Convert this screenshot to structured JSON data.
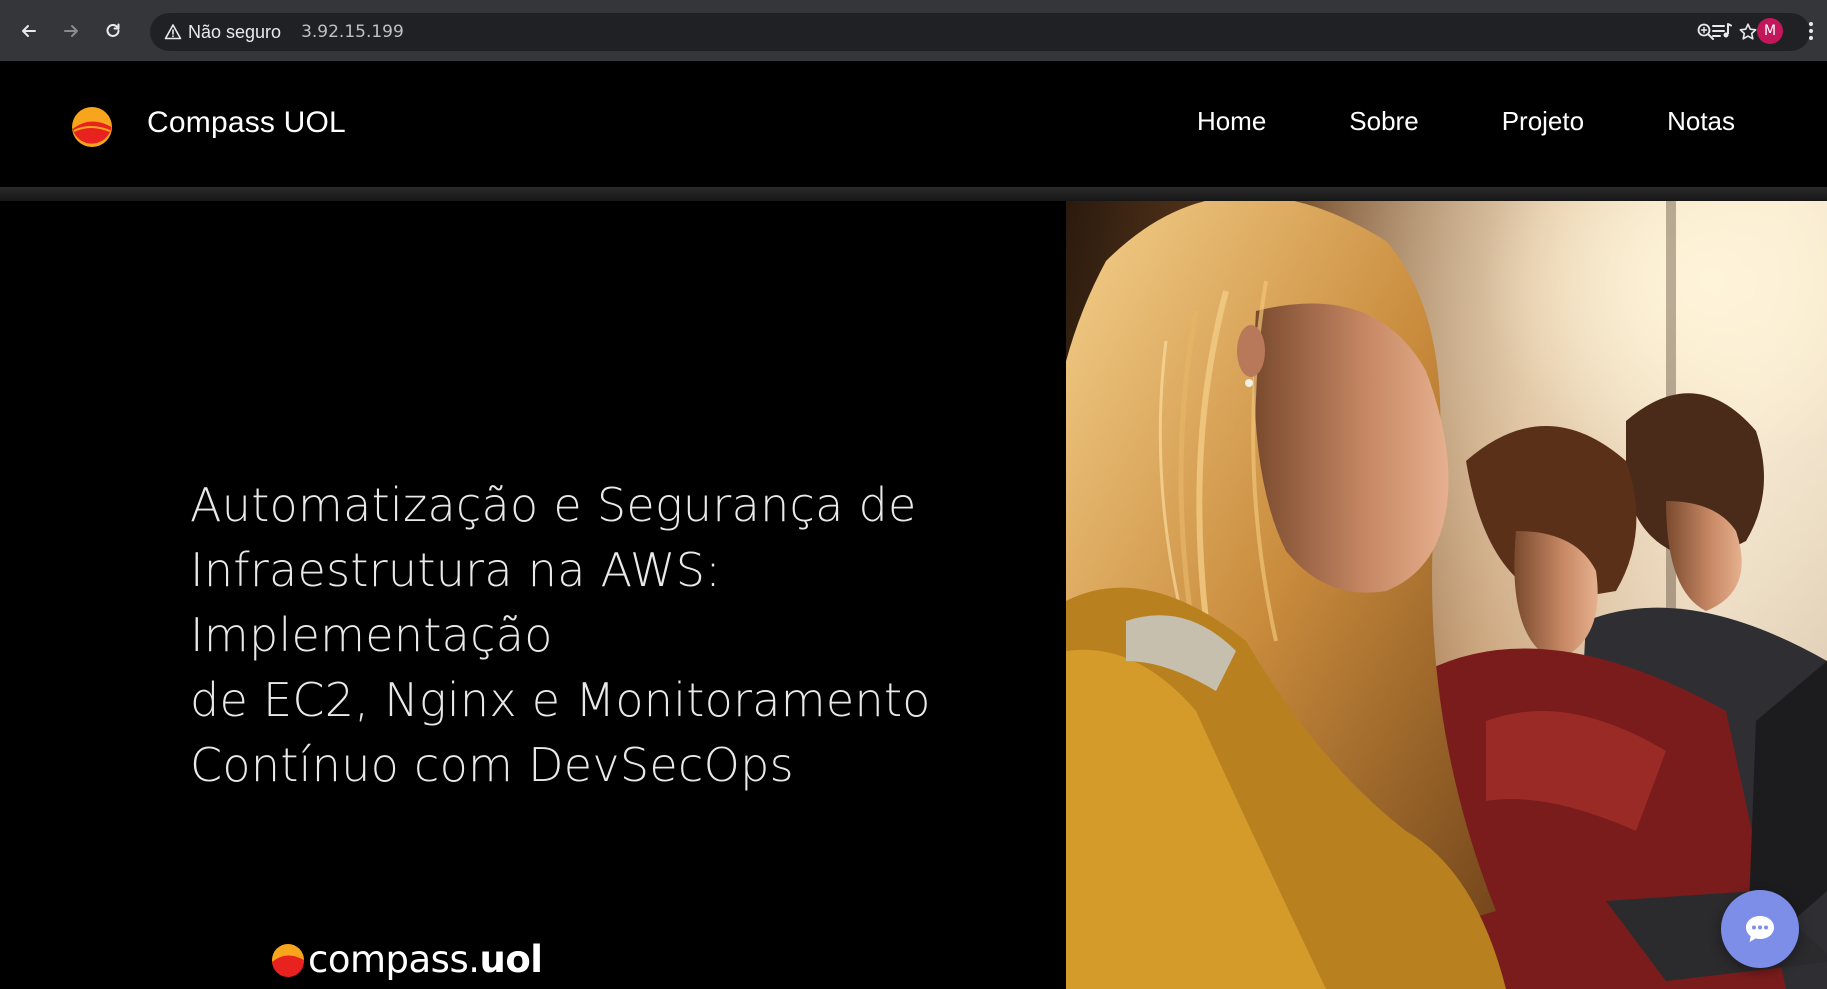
{
  "browser": {
    "security_label": "Não seguro",
    "url": "3.92.15.199",
    "profile_initial": "M",
    "icons": [
      "back-icon",
      "forward-icon",
      "reload-icon",
      "warning-icon",
      "zoom-icon",
      "star-icon",
      "media-icon",
      "menu-icon"
    ]
  },
  "header": {
    "brand_name": "Compass UOL",
    "nav": {
      "home": "Home",
      "sobre": "Sobre",
      "projeto": "Projeto",
      "notas": "Notas"
    }
  },
  "hero": {
    "title_lines": [
      "Automatização e Segurança de",
      "Infraestrutura na AWS: Implementação",
      "de EC2, Nginx e Monitoramento",
      "Contínuo com DevSecOps"
    ],
    "footer_wordmark_light": "compass.",
    "footer_wordmark_bold": "uol"
  },
  "colors": {
    "chrome_bg": "#35363a",
    "omnibox_bg": "#202124",
    "page_bg": "#000000",
    "brand_orange": "#f39a1e",
    "brand_red": "#e8221f",
    "chat_bubble": "#7c8ee8",
    "avatar": "#c2185b"
  }
}
